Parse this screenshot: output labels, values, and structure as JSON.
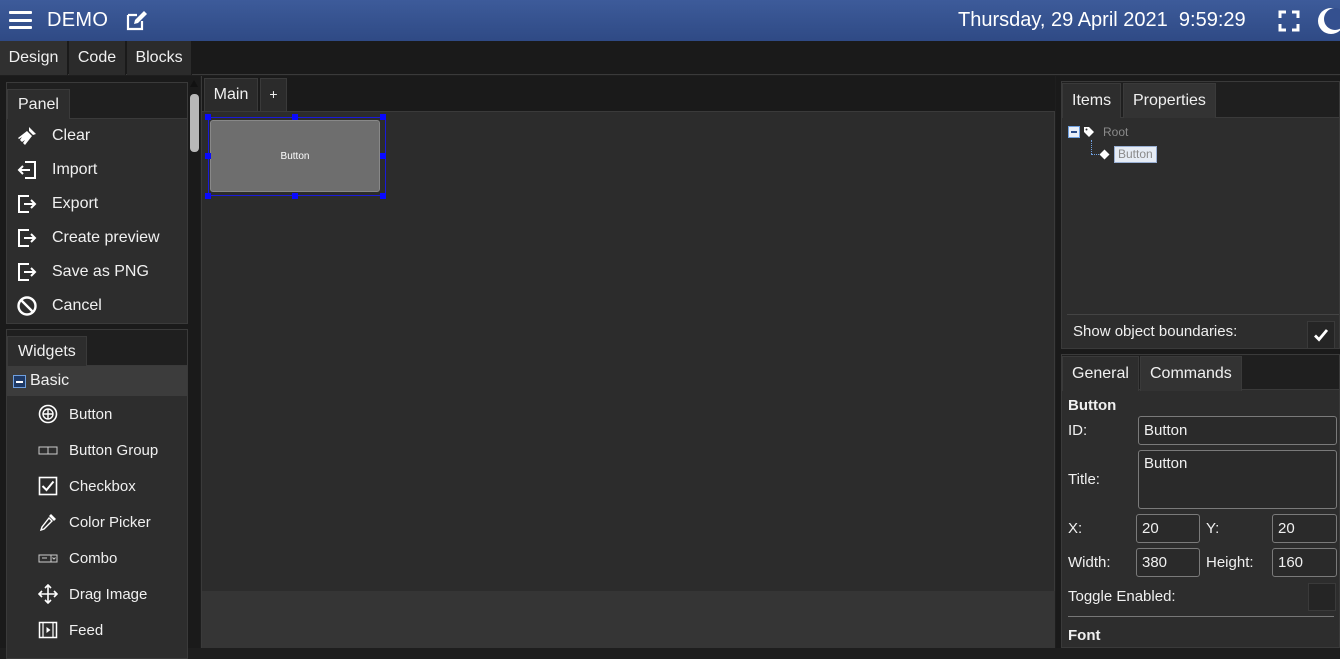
{
  "header": {
    "title": "DEMO",
    "date": "Thursday, 29 April 2021",
    "time": "9:59:29"
  },
  "mode_tabs": [
    {
      "label": "Design",
      "active": true
    },
    {
      "label": "Code",
      "active": false
    },
    {
      "label": "Blocks",
      "active": false
    }
  ],
  "panel": {
    "tab_label": "Panel",
    "items": [
      {
        "label": "Clear",
        "icon": "broom-icon"
      },
      {
        "label": "Import",
        "icon": "import-icon"
      },
      {
        "label": "Export",
        "icon": "export-icon"
      },
      {
        "label": "Create preview",
        "icon": "export-icon"
      },
      {
        "label": "Save as PNG",
        "icon": "export-icon"
      },
      {
        "label": "Cancel",
        "icon": "cancel-icon"
      }
    ]
  },
  "widgets": {
    "tab_label": "Widgets",
    "group_label": "Basic",
    "items": [
      {
        "label": "Button",
        "icon": "button-icon"
      },
      {
        "label": "Button Group",
        "icon": "button-group-icon"
      },
      {
        "label": "Checkbox",
        "icon": "checkbox-icon"
      },
      {
        "label": "Color Picker",
        "icon": "eyedropper-icon"
      },
      {
        "label": "Combo",
        "icon": "combo-icon"
      },
      {
        "label": "Drag Image",
        "icon": "move-icon"
      },
      {
        "label": "Feed",
        "icon": "film-icon"
      }
    ]
  },
  "doc_tabs": {
    "main_label": "Main",
    "add_label": "+"
  },
  "canvas": {
    "button_label": "Button"
  },
  "items_panel": {
    "tabs": [
      "Items",
      "Properties"
    ],
    "root_label": "Root",
    "child_label": "Button",
    "show_boundaries_label": "Show object boundaries:",
    "show_boundaries_checked": true
  },
  "props_panel": {
    "tabs": [
      "General",
      "Commands"
    ],
    "section_title": "Button",
    "id_label": "ID:",
    "id_value": "Button",
    "title_label": "Title:",
    "title_value": "Button",
    "x_label": "X:",
    "x_value": "20",
    "y_label": "Y:",
    "y_value": "20",
    "width_label": "Width:",
    "width_value": "380",
    "height_label": "Height:",
    "height_value": "160",
    "toggle_label": "Toggle Enabled:",
    "font_section": "Font"
  },
  "colors": {
    "header_bg": "#34508f",
    "selection": "#0a0aff",
    "panel_bg": "#2d2d2d"
  }
}
